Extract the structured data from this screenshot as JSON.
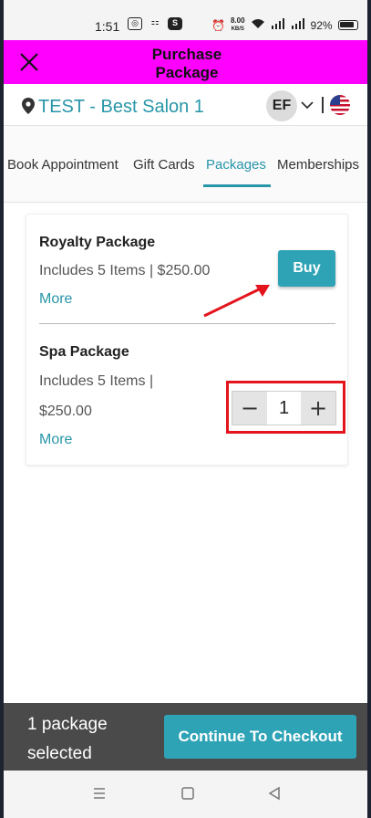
{
  "status_bar": {
    "time": "1:51",
    "speed_value": "8.00",
    "speed_unit": "KB/S",
    "battery": "92%"
  },
  "header": {
    "title_line1": "Purchase",
    "title_line2": "Package",
    "background_color": "#ff00ff"
  },
  "location": {
    "name": "TEST - Best Salon 1",
    "avatar_initials": "EF"
  },
  "tabs": [
    {
      "label": "Book Appointment",
      "active": false
    },
    {
      "label": "Gift Cards",
      "active": false
    },
    {
      "label": "Packages",
      "active": true
    },
    {
      "label": "Memberships",
      "active": false
    }
  ],
  "packages": [
    {
      "name": "Royalty Package",
      "description": "Includes 5 Items | $250.00",
      "more_label": "More",
      "action_label": "Buy"
    },
    {
      "name": "Spa Package",
      "description_line1": "Includes 5 Items |",
      "description_line2": "$250.00",
      "more_label": "More",
      "quantity": "1",
      "decrement_symbol": "−",
      "increment_symbol": "+"
    }
  ],
  "footer": {
    "selected_line1": "1 package",
    "selected_line2": "selected",
    "checkout_label": "Continue To Checkout"
  },
  "colors": {
    "accent": "#2896a8",
    "button": "#2fa3b6",
    "annotation": "#e4141d"
  },
  "icons": [
    "close-icon",
    "location-pin-icon",
    "chevron-down-icon",
    "us-flag-icon",
    "recents-icon",
    "home-icon",
    "back-icon"
  ]
}
